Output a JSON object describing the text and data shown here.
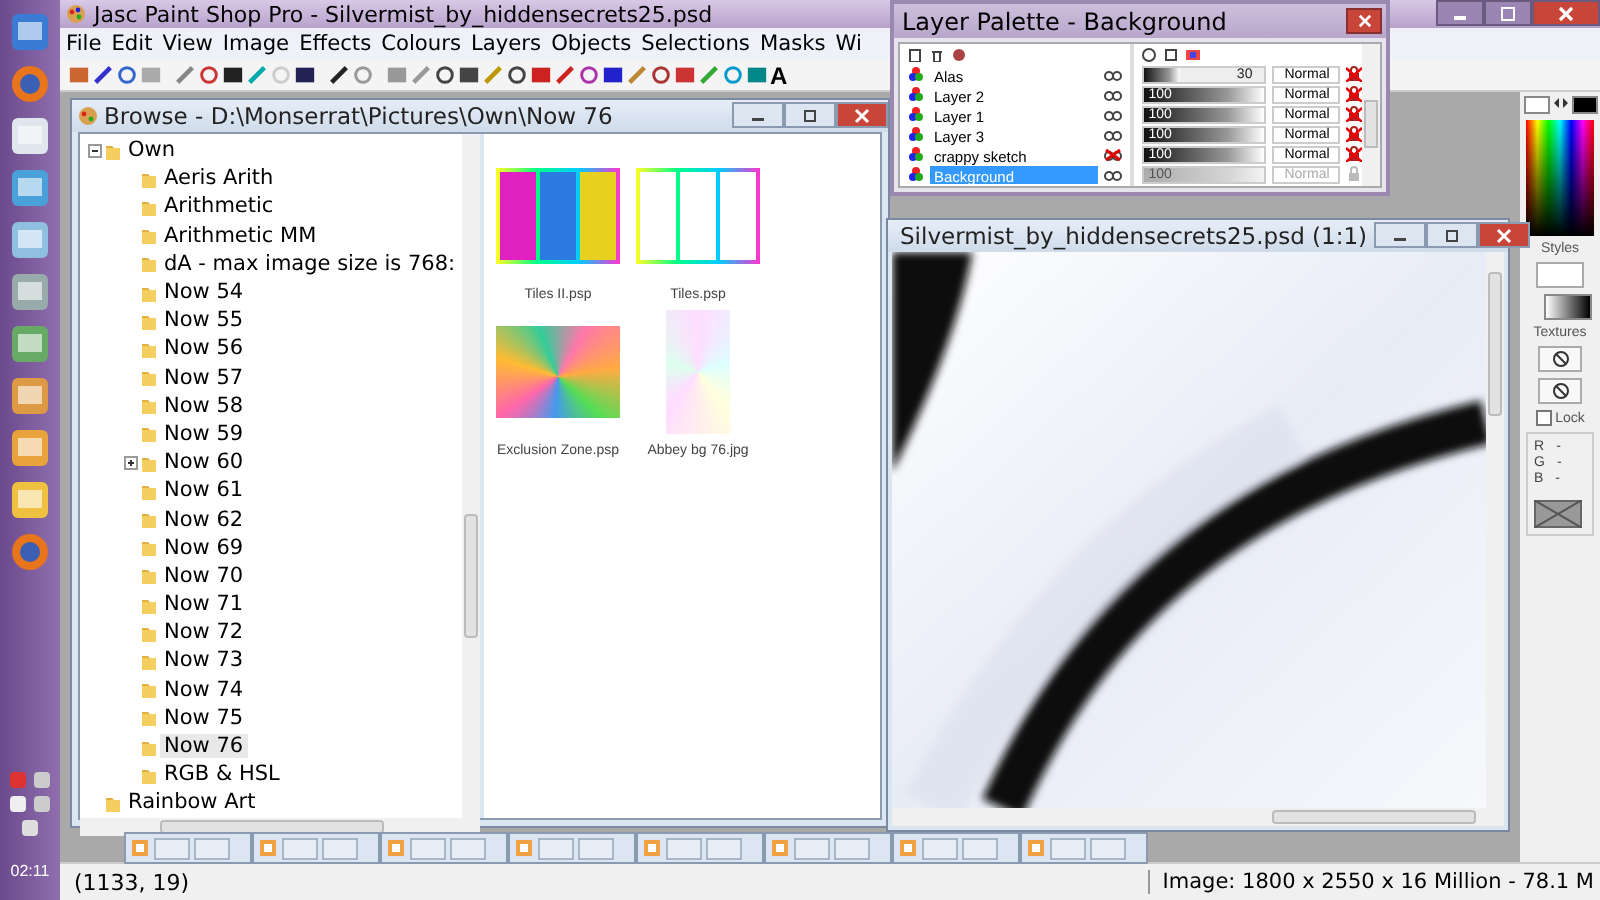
{
  "taskbar": {
    "clock": "02:11"
  },
  "app": {
    "title": "Jasc Paint Shop Pro - Silvermist_by_hiddensecrets25.psd",
    "menu": [
      "File",
      "Edit",
      "View",
      "Image",
      "Effects",
      "Colours",
      "Layers",
      "Objects",
      "Selections",
      "Masks",
      "Wi"
    ],
    "text_tool": "A"
  },
  "browse": {
    "title": "Browse - D:\\Monserrat\\Pictures\\Own\\Now 76",
    "tree": [
      {
        "label": "Own",
        "expanded": true,
        "selected": false,
        "children": [
          {
            "label": "Aeris Arith",
            "selected": false
          },
          {
            "label": "Arithmetic",
            "selected": false
          },
          {
            "label": "Arithmetic MM",
            "selected": false
          },
          {
            "label": "dA - max image size is 768:",
            "selected": false
          },
          {
            "label": "Now 54",
            "selected": false
          },
          {
            "label": "Now 55",
            "selected": false
          },
          {
            "label": "Now 56",
            "selected": false
          },
          {
            "label": "Now 57",
            "selected": false
          },
          {
            "label": "Now 58",
            "selected": false
          },
          {
            "label": "Now 59",
            "selected": false
          },
          {
            "label": "Now 60",
            "expanded": false,
            "selected": false
          },
          {
            "label": "Now 61",
            "selected": false
          },
          {
            "label": "Now 62",
            "selected": false
          },
          {
            "label": "Now 69",
            "selected": false
          },
          {
            "label": "Now 70",
            "selected": false
          },
          {
            "label": "Now 71",
            "selected": false
          },
          {
            "label": "Now 72",
            "selected": false
          },
          {
            "label": "Now 73",
            "selected": false
          },
          {
            "label": "Now 74",
            "selected": false
          },
          {
            "label": "Now 75",
            "selected": false
          },
          {
            "label": "Now 76",
            "selected": true
          },
          {
            "label": "RGB & HSL",
            "selected": false
          }
        ]
      },
      {
        "label": "Rainbow Art",
        "selected": false
      }
    ],
    "thumbnails": [
      {
        "name": "Tiles II.psp",
        "kind": "tiles"
      },
      {
        "name": "Tiles.psp",
        "kind": "frames"
      },
      {
        "name": "Exclusion Zone.psp",
        "kind": "swirl"
      },
      {
        "name": "Abbey bg 76.jpg",
        "kind": "pastel"
      }
    ]
  },
  "layer_palette": {
    "title": "Layer Palette - Background",
    "layers": [
      {
        "name": "Alas",
        "visible": true,
        "opacity": "30",
        "level": 0.3,
        "blend": "Normal",
        "disabled": false,
        "selected": false
      },
      {
        "name": "Layer 2",
        "visible": true,
        "opacity": "100",
        "level": 1,
        "blend": "Normal",
        "disabled": false,
        "selected": false
      },
      {
        "name": "Layer 1",
        "visible": true,
        "opacity": "100",
        "level": 1,
        "blend": "Normal",
        "disabled": false,
        "selected": false
      },
      {
        "name": "Layer 3",
        "visible": true,
        "opacity": "100",
        "level": 1,
        "blend": "Normal",
        "disabled": false,
        "selected": false
      },
      {
        "name": "crappy sketch",
        "visible": false,
        "opacity": "100",
        "level": 1,
        "blend": "Normal",
        "disabled": false,
        "selected": false
      },
      {
        "name": "Background",
        "visible": true,
        "opacity": "100",
        "level": 1,
        "blend": "Normal",
        "disabled": true,
        "selected": true
      }
    ]
  },
  "image_window": {
    "title": "Silvermist_by_hiddensecrets25.psd (1:1)"
  },
  "minimized_windows": [
    {
      "kind": "image"
    },
    {
      "kind": "image"
    },
    {
      "kind": "image"
    },
    {
      "kind": "image"
    },
    {
      "kind": "image"
    },
    {
      "kind": "image"
    },
    {
      "kind": "image"
    },
    {
      "kind": "image"
    }
  ],
  "style_palette": {
    "styles_label": "Styles",
    "textures_label": "Textures",
    "lock": {
      "label": "Lock",
      "checked": false
    },
    "rgb": [
      {
        "channel": "R",
        "value": "-"
      },
      {
        "channel": "G",
        "value": "-"
      },
      {
        "channel": "B",
        "value": "-"
      }
    ]
  },
  "status_bar": {
    "coordinates": "(1133, 19)",
    "image_info": "Image:  1800 x 2550 x 16 Million - 78.1 M"
  }
}
